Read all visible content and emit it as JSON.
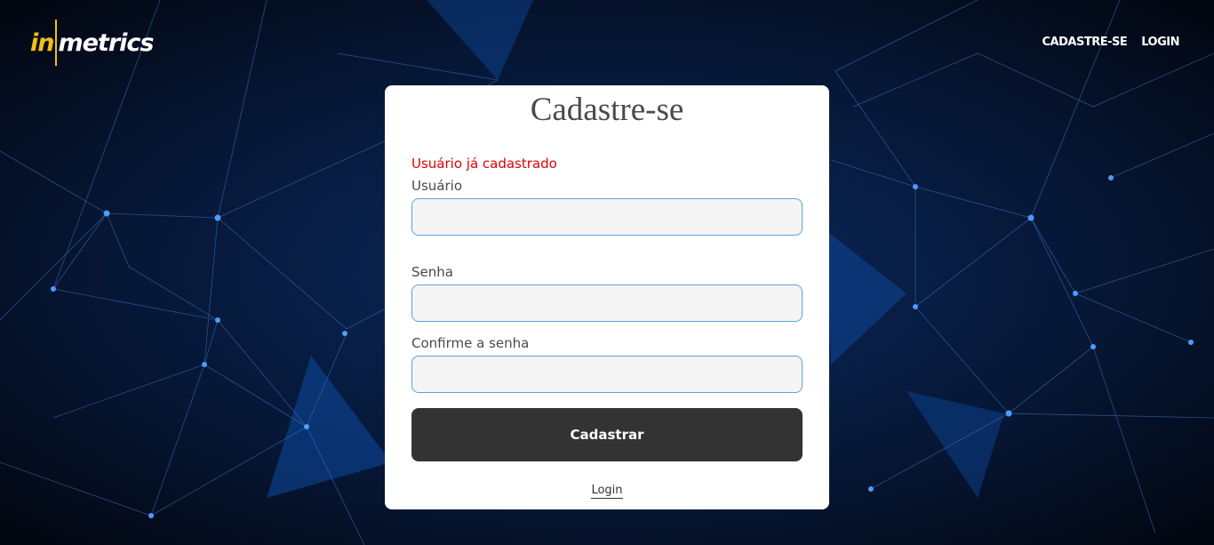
{
  "brand": {
    "logo_in": "in",
    "logo_metrics": "metrics",
    "accent_color": "#f2c011"
  },
  "nav": {
    "signup": "CADASTRE-SE",
    "login": "LOGIN"
  },
  "form": {
    "title": "Cadastre-se",
    "error_message": "Usuário já cadastrado",
    "error_color": "#e00000",
    "username_label": "Usuário",
    "username_value": "",
    "password_label": "Senha",
    "password_value": "",
    "confirm_label": "Confirme a senha",
    "confirm_value": "",
    "submit_label": "Cadastrar",
    "login_link": "Login"
  }
}
